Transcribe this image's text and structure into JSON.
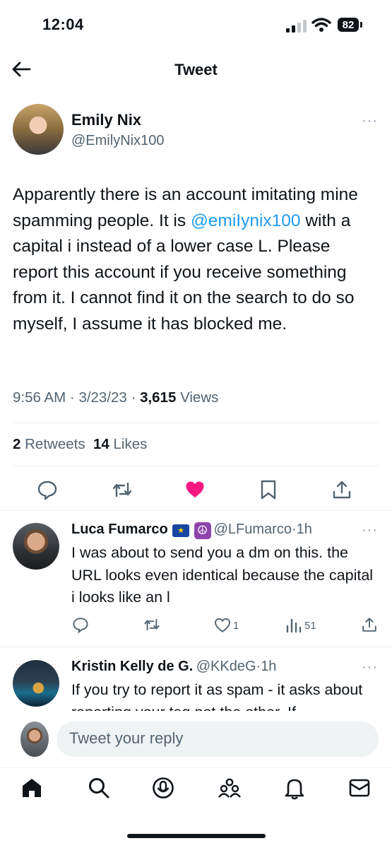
{
  "status_bar": {
    "time": "12:04",
    "battery": "82"
  },
  "header": {
    "title": "Tweet"
  },
  "tweet": {
    "author_name": "Emily Nix",
    "author_handle": "@EmilyNix100",
    "more": "···",
    "text_before": "Apparently there is an account imitating mine spamming people. It is ",
    "mention": "@emiIynix100",
    "text_after": " with a capital i instead of a lower case L. Please report this account if you receive something from it. I cannot find it on the search to do so myself, I assume it has blocked me.",
    "time": "9:56 AM",
    "date": "3/23/23",
    "views_count": "3,615",
    "views_label": "Views",
    "retweets_count": "2",
    "retweets_label": "Retweets",
    "likes_count": "14",
    "likes_label": "Likes",
    "liked": true
  },
  "replies": [
    {
      "name": "Luca Fumarco",
      "handle": "@LFumarco",
      "time": "1h",
      "text": "I was about to send you a dm on this. the URL looks even identical because the capital i looks like an l",
      "likes": "1",
      "views": "51"
    },
    {
      "name": "Kristin Kelly de G.",
      "handle": "@KKdeG",
      "time": "1h",
      "text": "If you try to report it as spam - it asks about reporting your tag not the other. If"
    }
  ],
  "reply_input": {
    "placeholder": "Tweet your reply"
  },
  "colors": {
    "accent": "#1d9bf0",
    "like": "#f91880",
    "text": "#0f1419",
    "secondary": "#536471"
  }
}
